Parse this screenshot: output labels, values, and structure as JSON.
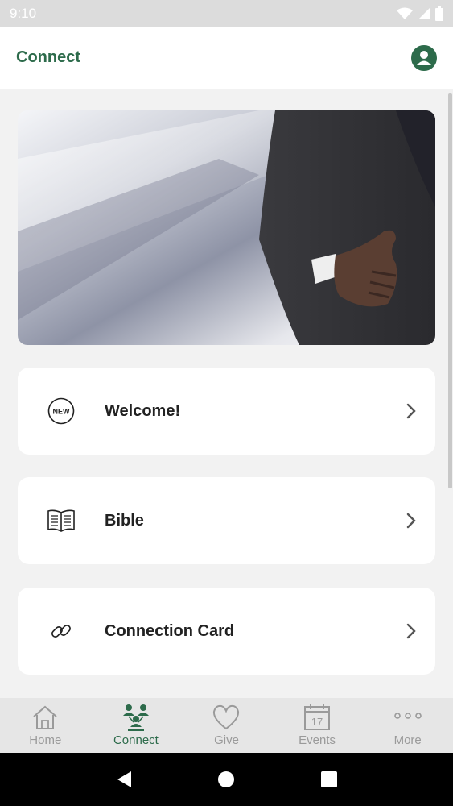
{
  "status_bar": {
    "time": "9:10"
  },
  "app_bar": {
    "title": "Connect"
  },
  "cards": [
    {
      "label": "Welcome!",
      "icon": "new-badge-icon"
    },
    {
      "label": "Bible",
      "icon": "open-book-icon"
    },
    {
      "label": "Connection Card",
      "icon": "link-icon"
    }
  ],
  "new_badge_text": "NEW",
  "bottom_nav": [
    {
      "label": "Home",
      "icon": "home-icon",
      "active": false
    },
    {
      "label": "Connect",
      "icon": "people-icon",
      "active": true
    },
    {
      "label": "Give",
      "icon": "heart-icon",
      "active": false
    },
    {
      "label": "Events",
      "icon": "calendar-icon",
      "active": false
    },
    {
      "label": "More",
      "icon": "more-dots-icon",
      "active": false
    }
  ],
  "calendar_day": "17",
  "colors": {
    "accent": "#2d6b4b",
    "inactive": "#9a9a9a"
  }
}
